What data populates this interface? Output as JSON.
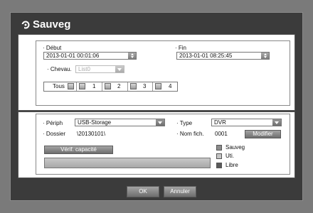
{
  "dialog": {
    "title": "Sauveg"
  },
  "range": {
    "start_label": "Début",
    "start_value": "2013-01-01 00:01:06",
    "end_label": "Fin",
    "end_value": "2013-01-01 08:25:45",
    "overlap_label": "Chevau.",
    "overlap_value": "List0"
  },
  "channels": {
    "all_label": "Tous",
    "items": [
      "1",
      "2",
      "3",
      "4"
    ]
  },
  "device": {
    "device_label": "Périph",
    "device_value": "USB-Storage",
    "type_label": "Type",
    "type_value": "DVR",
    "folder_label": "Dossier",
    "folder_value": "\\20130101\\",
    "filename_label": "Nom fich.",
    "filename_value": "0001",
    "modify_button": "Modifier",
    "check_capacity_button": "Vérif. capacité",
    "legend": [
      {
        "label": "Sauveg",
        "color": "#8c8c8c"
      },
      {
        "label": "Uti.",
        "color": "#c6c6c6"
      },
      {
        "label": "Libre",
        "color": "#5a5a5a"
      }
    ]
  },
  "footer": {
    "ok_button": "OK",
    "cancel_button": "Annuler"
  }
}
